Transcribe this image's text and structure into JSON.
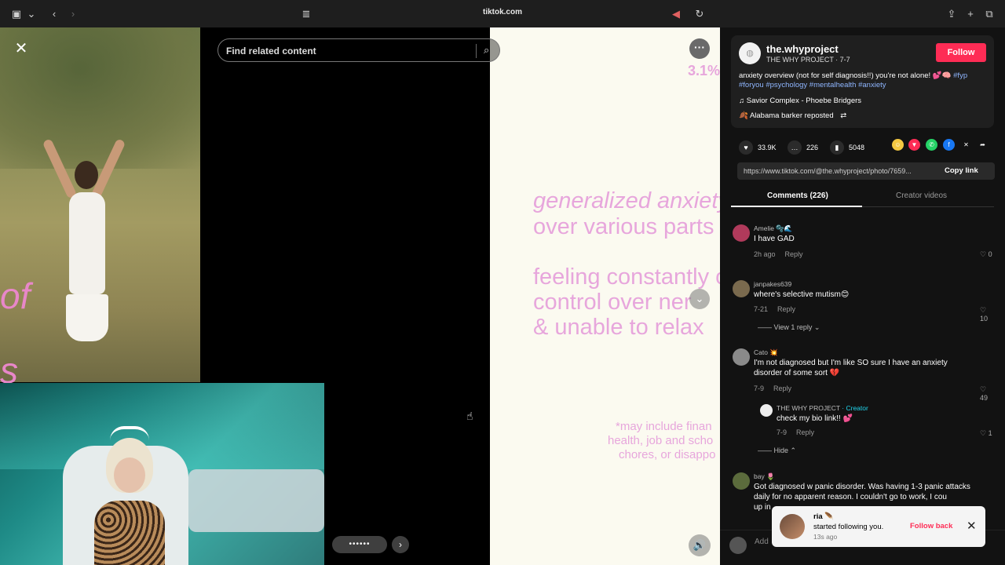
{
  "browser": {
    "url": "tiktok.com",
    "icons": [
      "sidebar-icon",
      "chevron-down-icon",
      "back-icon",
      "forward-icon",
      "reader-icon",
      "sound-icon",
      "reload-icon",
      "share-icon",
      "new-tab-icon",
      "tabs-icon"
    ]
  },
  "viewer": {
    "search_placeholder": "Find related content",
    "percent_label": "3.1%",
    "slide_lines": {
      "l1": "generalized anxiety",
      "l2": "over various parts o",
      "l3": "feeling  constantly  o",
      "l4": "control  over  ner",
      "l5": "& unable to relax",
      "s1": "*may include finan",
      "s2": "health, job and scho",
      "s3": "chores, or disappo"
    },
    "left_letters": [
      "of",
      "s"
    ],
    "dots": "••••••"
  },
  "post": {
    "username": "the.whyproject",
    "subtitle": "THE WHY PROJECT · 7-7",
    "follow_label": "Follow",
    "desc_text": "anxiety overview (not for self diagnosis!!) you're not alone! 💕🧠",
    "tags": [
      "#fyp",
      "#foryou",
      "#psychology",
      "#mentalhealth",
      "#anxiety"
    ],
    "music": "♫  Savior Complex - Phoebe Bridgers",
    "repost": "🍂 Alabama barker reposted",
    "likes": "33.9K",
    "comments": "226",
    "saves": "5048",
    "link": "https://www.tiktok.com/@the.whyproject/photo/7659...",
    "copy_label": "Copy link",
    "tab_comments": "Comments (226)",
    "tab_creator": "Creator videos"
  },
  "comments": [
    {
      "name": "Amelie 🫧🌊",
      "text": "I have GAD",
      "time": "2h ago",
      "reply": "Reply",
      "likes": "0"
    },
    {
      "name": "janpakes639",
      "text": "where's selective mutism😊",
      "time": "7-21",
      "reply": "Reply",
      "likes": "10",
      "view_replies": "View 1 reply"
    },
    {
      "name": "Cato 💥",
      "text": "I'm not diagnosed but I'm like SO sure I have an anxiety disorder of some sort 💔",
      "time": "7-9",
      "reply": "Reply",
      "likes": "49"
    },
    {
      "name": "THE WHY PROJECT",
      "creator": "· Creator",
      "text": "check my bio link!! 💕",
      "time": "7-9",
      "reply": "Reply",
      "likes": "1",
      "hide": "Hide"
    },
    {
      "name": "bay 🌷",
      "text": "Got diagnosed w panic disorder. Was having 1-3 panic attacks daily for no apparent reason. I couldn't go to work, I cou",
      "text2": "up in",
      "time": "",
      "reply": "",
      "likes": ""
    }
  ],
  "input": {
    "placeholder": "Add"
  },
  "toast": {
    "name": "ria 🪶",
    "message": "started following you.",
    "time": "13s ago",
    "follow_back": "Follow back"
  }
}
